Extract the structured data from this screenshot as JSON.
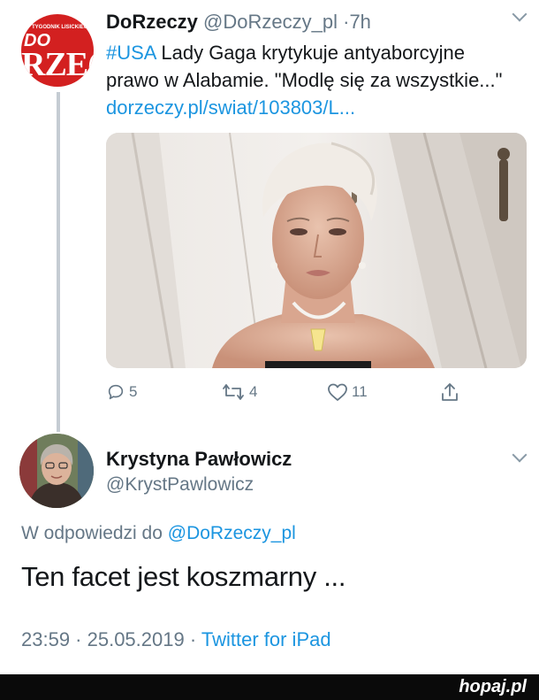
{
  "tweet": {
    "author_name": "DoRzeczy",
    "author_handle": "@DoRzeczy_pl",
    "separator": "·",
    "time": "7h",
    "avatar": {
      "small_text": "TYGODNIK LISICKIEGO",
      "line1": "DO",
      "line2": "RZE("
    },
    "hashtag": "#USA",
    "text_part1": " Lady Gaga krytykuje antyaborcyjne prawo w Alabamie. \"Modlę się za wszystkie...\" ",
    "link": "dorzeczy.pl/swiat/103803/L...",
    "actions": {
      "reply_count": "5",
      "retweet_count": "4",
      "like_count": "11"
    }
  },
  "reply": {
    "author_name": "Krystyna Pawłowicz",
    "author_handle": "@KrystPawlowicz",
    "reply_prefix": "W odpowiedzi do ",
    "reply_to_handle": "@DoRzeczy_pl",
    "text": "Ten facet jest koszmarny ...",
    "timestamp": "23:59 · 25.05.2019 · ",
    "source": "Twitter for iPad"
  },
  "watermark": {
    "text": "hopaj",
    "suffix": ".pl"
  },
  "colors": {
    "link": "#1b95e0",
    "secondary_text": "#657786",
    "avatar_brand": "#d32020"
  }
}
